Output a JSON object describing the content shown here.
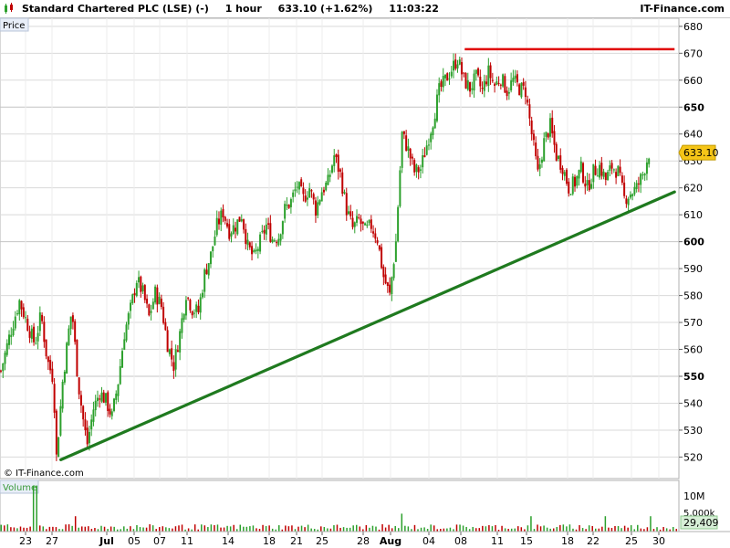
{
  "header": {
    "instrument": "Standard Chartered PLC (LSE) (-)",
    "interval": "1 hour",
    "quote": "633.10 (+1.62%)",
    "time": "11:03:22",
    "brand": "IT-Finance.com"
  },
  "price_panel": {
    "label": "Price",
    "watermark": "© IT-Finance.com"
  },
  "volume_panel": {
    "label": "Volume",
    "tick_labels": [
      "10M",
      "5,000k"
    ],
    "last_value_label": "29,409"
  },
  "colors": {
    "up": "#2ca02c",
    "down": "#c00000",
    "support_line": "#1f7a1f",
    "resistance_line": "#e00000",
    "last_price_bg": "#f5c518",
    "grid": "#d9d9d9"
  },
  "chart_data": [
    {
      "type": "candlestick",
      "title": "Standard Chartered PLC (LSE) (-)",
      "interval": "1 hour",
      "ylim": [
        512,
        683
      ],
      "y_ticks": [
        520,
        530,
        540,
        550,
        560,
        570,
        580,
        590,
        600,
        610,
        620,
        630,
        640,
        650,
        660,
        670,
        680
      ],
      "y_ticks_bold": [
        550,
        600,
        650
      ],
      "x_tick_labels": [
        "23",
        "27",
        "Jul",
        "05",
        "07",
        "11",
        "14",
        "18",
        "21",
        "25",
        "28",
        "Aug",
        "04",
        "08",
        "11",
        "15",
        "18",
        "22",
        "25",
        "30"
      ],
      "x_ticks_bold": [
        "Jul",
        "Aug"
      ],
      "grid": true,
      "last_price": "633.10",
      "price_path": [
        [
          0,
          552
        ],
        [
          3,
          566
        ],
        [
          6,
          578
        ],
        [
          9,
          568
        ],
        [
          11,
          562
        ],
        [
          13,
          573
        ],
        [
          15,
          556
        ],
        [
          17,
          549
        ],
        [
          18,
          520
        ],
        [
          20,
          548
        ],
        [
          22,
          567
        ],
        [
          23,
          575
        ],
        [
          25,
          548
        ],
        [
          27,
          531
        ],
        [
          28,
          525
        ],
        [
          30,
          538
        ],
        [
          32,
          544
        ],
        [
          34,
          541
        ],
        [
          36,
          535
        ],
        [
          38,
          548
        ],
        [
          40,
          566
        ],
        [
          42,
          575
        ],
        [
          44,
          586
        ],
        [
          46,
          581
        ],
        [
          48,
          572
        ],
        [
          50,
          581
        ],
        [
          52,
          576
        ],
        [
          54,
          562
        ],
        [
          56,
          554
        ],
        [
          58,
          566
        ],
        [
          60,
          581
        ],
        [
          62,
          575
        ],
        [
          64,
          574
        ],
        [
          66,
          588
        ],
        [
          68,
          595
        ],
        [
          70,
          606
        ],
        [
          72,
          611
        ],
        [
          74,
          604
        ],
        [
          76,
          606
        ],
        [
          78,
          610
        ],
        [
          80,
          598
        ],
        [
          82,
          594
        ],
        [
          84,
          600
        ],
        [
          86,
          606
        ],
        [
          88,
          601
        ],
        [
          90,
          602
        ],
        [
          92,
          612
        ],
        [
          94,
          615
        ],
        [
          96,
          621
        ],
        [
          98,
          616
        ],
        [
          100,
          620
        ],
        [
          102,
          612
        ],
        [
          104,
          619
        ],
        [
          106,
          622
        ],
        [
          108,
          632
        ],
        [
          110,
          625
        ],
        [
          112,
          612
        ],
        [
          114,
          605
        ],
        [
          116,
          608
        ],
        [
          118,
          604
        ],
        [
          120,
          606
        ],
        [
          122,
          601
        ],
        [
          124,
          587
        ],
        [
          126,
          580
        ],
        [
          128,
          600
        ],
        [
          130,
          640
        ],
        [
          132,
          634
        ],
        [
          134,
          626
        ],
        [
          136,
          627
        ],
        [
          138,
          636
        ],
        [
          140,
          645
        ],
        [
          142,
          656
        ],
        [
          144,
          660
        ],
        [
          146,
          664
        ],
        [
          148,
          668
        ],
        [
          150,
          660
        ],
        [
          152,
          657
        ],
        [
          154,
          661
        ],
        [
          156,
          656
        ],
        [
          158,
          663
        ],
        [
          160,
          658
        ],
        [
          162,
          661
        ],
        [
          164,
          656
        ],
        [
          166,
          660
        ],
        [
          168,
          657
        ],
        [
          170,
          656
        ],
        [
          172,
          640
        ],
        [
          174,
          625
        ],
        [
          176,
          637
        ],
        [
          178,
          643
        ],
        [
          180,
          632
        ],
        [
          182,
          628
        ],
        [
          184,
          620
        ],
        [
          186,
          622
        ],
        [
          188,
          627
        ],
        [
          190,
          620
        ],
        [
          192,
          626
        ],
        [
          194,
          628
        ],
        [
          196,
          623
        ],
        [
          198,
          628
        ],
        [
          200,
          626
        ],
        [
          202,
          616
        ],
        [
          204,
          618
        ],
        [
          206,
          620
        ],
        [
          208,
          625
        ],
        [
          210,
          633
        ]
      ],
      "annotations": [
        {
          "type": "trendline",
          "name": "support",
          "x": [
            20,
            218
          ],
          "y": [
            519,
            618.5
          ]
        },
        {
          "type": "horizontal_line",
          "name": "resistance",
          "x": [
            150,
            218
          ],
          "y": 671.5
        }
      ]
    },
    {
      "type": "bar",
      "title": "Volume",
      "y_tick_labels": [
        "10M",
        "5,000k"
      ],
      "last_value": "29,409",
      "spikes": [
        [
          11,
          0.9
        ],
        [
          130,
          0.35
        ],
        [
          196,
          0.3
        ],
        [
          172,
          0.3
        ],
        [
          24,
          0.3
        ],
        [
          210,
          0.3
        ]
      ]
    }
  ]
}
